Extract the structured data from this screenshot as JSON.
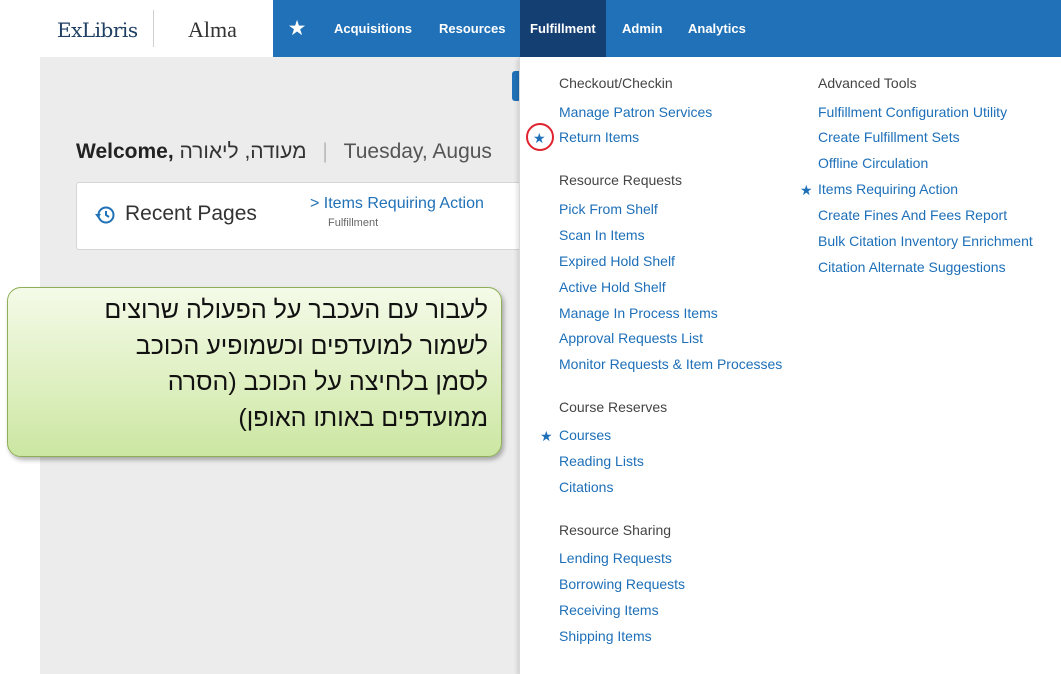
{
  "brand": {
    "vendor": "ExLibris",
    "product": "Alma"
  },
  "topnav": {
    "favorites_icon": "star-icon",
    "items": [
      "Acquisitions",
      "Resources",
      "Fulfillment",
      "Admin",
      "Analytics"
    ],
    "active": "Fulfillment"
  },
  "welcome": {
    "greeting": "Welcome,",
    "name": "מעודה, ליאורה",
    "date": "Tuesday, Augus"
  },
  "recent": {
    "title": "Recent Pages",
    "link": "> Items Requiring Action",
    "link_sub": "Fulfillment"
  },
  "menu": {
    "checkout": {
      "heading": "Checkout/Checkin",
      "items": [
        "Manage Patron Services",
        "Return Items"
      ]
    },
    "requests": {
      "heading": "Resource Requests",
      "items": [
        "Pick From Shelf",
        "Scan In Items",
        "Expired Hold Shelf",
        "Active Hold Shelf",
        "Manage In Process Items",
        "Approval Requests List",
        "Monitor Requests & Item Processes"
      ]
    },
    "course": {
      "heading": "Course Reserves",
      "items": [
        "Courses",
        "Reading Lists",
        "Citations"
      ]
    },
    "sharing": {
      "heading": "Resource Sharing",
      "items": [
        "Lending Requests",
        "Borrowing Requests",
        "Receiving Items",
        "Shipping Items"
      ]
    },
    "advanced": {
      "heading": "Advanced Tools",
      "items": [
        "Fulfillment Configuration Utility",
        "Create Fulfillment Sets",
        "Offline Circulation",
        "Items Requiring Action",
        "Create Fines And Fees Report",
        "Bulk Citation Inventory Enrichment",
        "Citation Alternate Suggestions"
      ]
    },
    "favorites": [
      "Return Items",
      "Items Requiring Action",
      "Courses"
    ]
  },
  "callout": {
    "lines": [
      "לעבור עם העכבר על הפעולה שרוצים",
      "לשמור למועדפים וכשמופיע הכוכב",
      "לסמן בלחיצה על הכוכב (הסרה",
      "ממועדפים באותו האופן)"
    ]
  },
  "colors": {
    "accent": "#2071b7",
    "active_tab": "#143f73",
    "link": "#1d6fb8",
    "highlight_circle": "#e0232f",
    "callout_fill": "#dff0c2"
  }
}
